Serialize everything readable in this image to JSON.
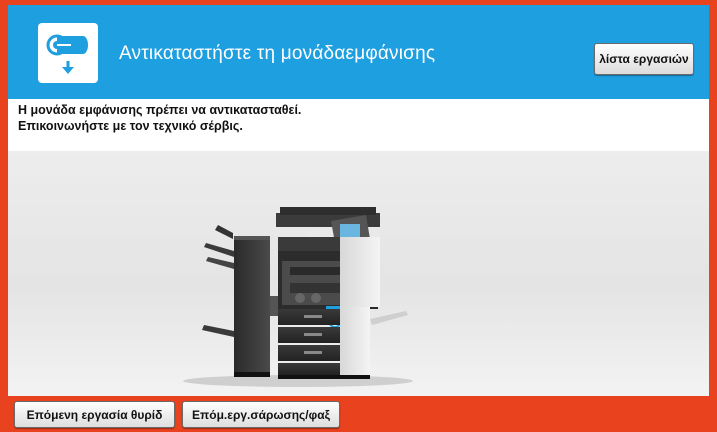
{
  "header": {
    "title": "Αντικαταστήστε τη μονάδαεμφάνισης",
    "icon": "drum-unit-replace-icon",
    "job_list_label": "λίστα εργασιών"
  },
  "message": {
    "line1": "Η μονάδα εμφάνισης πρέπει να αντικατασταθεί.",
    "line2": "Επικοινωνήστε με τον τεχνικό σέρβις."
  },
  "footer": {
    "next_job_label": "Επόμενη εργασία θυρίδ",
    "next_scan_fax_label": "Επόμ.εργ.σάρωσης/φαξ"
  },
  "colors": {
    "header_bg": "#1e9fe0",
    "frame_accent": "#e8421e",
    "indicator_blue": "#1e9fe0"
  }
}
